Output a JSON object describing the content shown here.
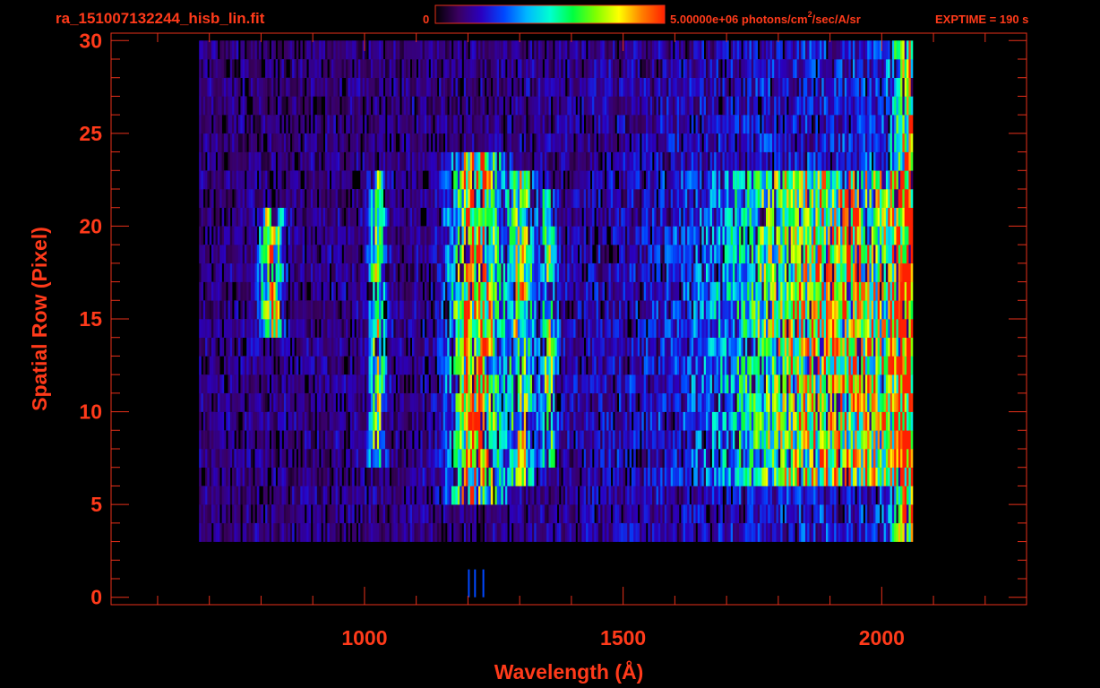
{
  "header": {
    "filename": "ra_151007132244_hisb_lin.fit",
    "colorbar_min_label": "0",
    "colorbar_max_label_prefix": "5.00000e+06 photons/cm",
    "colorbar_max_label_sup": "2",
    "colorbar_max_label_suffix": "/sec/A/sr",
    "exptime_label": "EXPTIME = 190 s"
  },
  "colors": {
    "text": "#ff3a1a",
    "axis": "#e8301a",
    "background": "#000000",
    "colormap": [
      "#000000",
      "#3a0060",
      "#2a00c0",
      "#0048ff",
      "#00b8ff",
      "#00ffd0",
      "#00ff40",
      "#80ff00",
      "#ffff00",
      "#ff8000",
      "#ff2000"
    ]
  },
  "chart_data": {
    "type": "heatmap",
    "title": "ra_151007132244_hisb_lin.fit",
    "xlabel": "Wavelength (Å)",
    "ylabel": "Spatial Row (Pixel)",
    "xlim": [
      510,
      2280
    ],
    "ylim": [
      -0.4,
      30.4
    ],
    "x_ticks": [
      1000,
      1500,
      2000
    ],
    "y_ticks": [
      0,
      5,
      10,
      15,
      20,
      25,
      30
    ],
    "x_minor_step": 100,
    "y_minor_step": 1,
    "grid": false,
    "colorbar": {
      "min": 0,
      "max": 5000000,
      "units": "photons/cm^2/sec/A/sr",
      "placement": "top"
    },
    "data_extent": {
      "x": [
        680,
        2060
      ],
      "y": [
        3,
        30
      ]
    },
    "emission_features": [
      {
        "center_wavelength": 820,
        "width": 20,
        "rows": [
          14,
          21
        ],
        "peak_fraction": 0.62
      },
      {
        "center_wavelength": 1025,
        "width": 14,
        "rows": [
          7,
          23
        ],
        "peak_fraction": 0.48
      },
      {
        "center_wavelength": 1216,
        "width": 45,
        "rows": [
          5,
          24
        ],
        "peak_fraction": 0.72
      },
      {
        "center_wavelength": 1304,
        "width": 22,
        "rows": [
          6,
          23
        ],
        "peak_fraction": 0.5
      },
      {
        "center_wavelength": 1356,
        "width": 14,
        "rows": [
          7,
          22
        ],
        "peak_fraction": 0.42
      },
      {
        "center_wavelength": 1900,
        "width": 190,
        "rows": [
          6,
          23
        ],
        "peak_fraction": 0.5
      },
      {
        "center_wavelength": 2050,
        "width": 24,
        "rows": [
          3,
          30
        ],
        "peak_fraction": 0.58
      }
    ],
    "exptime_seconds": 190
  }
}
